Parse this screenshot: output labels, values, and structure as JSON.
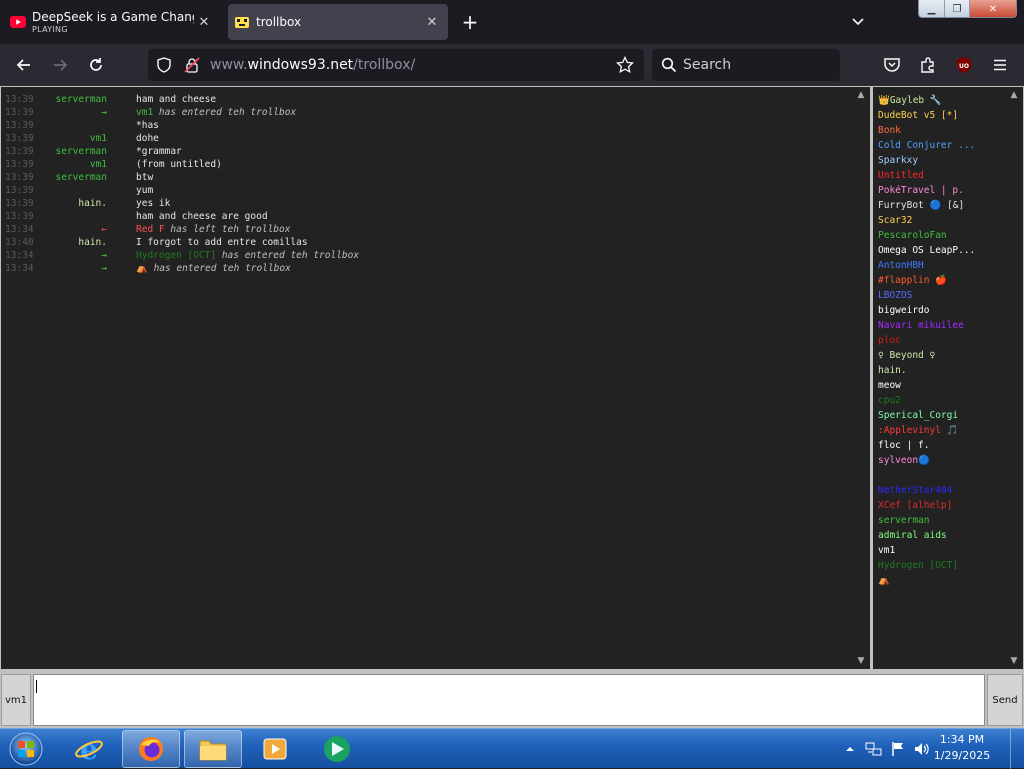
{
  "browser": {
    "tabs": [
      {
        "title": "DeepSeek is a Game Changer fo",
        "subtitle": "PLAYING",
        "active": false
      },
      {
        "title": "trollbox",
        "subtitle": "",
        "active": true
      }
    ],
    "url": {
      "prefix": "www.",
      "domain": "windows93.net",
      "path": "/trollbox/"
    },
    "search_placeholder": "Search",
    "colors": {
      "tabstrip": "#1c1b22",
      "active_tab": "#42414d",
      "toolbar": "#2b2a33"
    }
  },
  "chat": {
    "messages": [
      {
        "time": "13:39",
        "nick": "serverman",
        "nick_color": "#3fbf3f",
        "text": "ham and cheese",
        "type": "msg"
      },
      {
        "time": "13:39",
        "nick": "→",
        "nick_color": "#3ed83e",
        "who": "vm1",
        "who_color": "#3fbf3f",
        "text": "has entered teh trollbox",
        "type": "sys"
      },
      {
        "time": "13:39",
        "nick": "",
        "nick_color": "#3fbf3f",
        "text": "*has",
        "type": "msg"
      },
      {
        "time": "13:39",
        "nick": "vm1",
        "nick_color": "#3fbf3f",
        "text": "dohe",
        "type": "msg"
      },
      {
        "time": "13:39",
        "nick": "serverman",
        "nick_color": "#3fbf3f",
        "text": "*grammar",
        "type": "msg"
      },
      {
        "time": "13:39",
        "nick": "vm1",
        "nick_color": "#3fbf3f",
        "text": "(from untitled)",
        "type": "msg"
      },
      {
        "time": "13:39",
        "nick": "serverman",
        "nick_color": "#3fbf3f",
        "text": "btw",
        "type": "msg"
      },
      {
        "time": "13:39",
        "nick": "",
        "nick_color": "#3fbf3f",
        "text": "yum",
        "type": "msg"
      },
      {
        "time": "13:39",
        "nick": "hain.",
        "nick_color": "#cfe8a6",
        "text": "yes ik",
        "type": "msg"
      },
      {
        "time": "13:39",
        "nick": "",
        "nick_color": "#cfe8a6",
        "text": "ham and cheese are good",
        "type": "msg"
      },
      {
        "time": "13:34",
        "nick": "←",
        "nick_color": "#ff5252",
        "who": "Red F",
        "who_color": "#ff5252",
        "text": "has left teh trollbox",
        "type": "sys"
      },
      {
        "time": "13:40",
        "nick": "hain.",
        "nick_color": "#cfe8a6",
        "text": "I forgot to add entre comillas",
        "type": "msg"
      },
      {
        "time": "13:34",
        "nick": "→",
        "nick_color": "#3ed83e",
        "who": "Hydrogen [OCT]",
        "who_color": "#1f7a1f",
        "text": "has entered teh trollbox",
        "type": "sys"
      },
      {
        "time": "13:34",
        "nick": "→",
        "nick_color": "#3ed83e",
        "who": "⛺",
        "who_color": "#ff6b6b",
        "text": "has entered teh trollbox",
        "type": "sys"
      }
    ],
    "users": [
      {
        "name": "👑Gayleb 🔧",
        "color": "#cfe8a6"
      },
      {
        "name": "DudeBot v5 [*]",
        "color": "#ffd24a"
      },
      {
        "name": "Bonk",
        "color": "#ff6b3d"
      },
      {
        "name": "Cold Conjurer ...",
        "color": "#4fa0ff"
      },
      {
        "name": "Sparkxy",
        "color": "#9fd0ff"
      },
      {
        "name": "Untitled",
        "color": "#ff2a2a"
      },
      {
        "name": "PokéTravel | p.",
        "color": "#ff8ad8"
      },
      {
        "name": "FurryBot 🔵 [&]",
        "color": "#e0e0e0"
      },
      {
        "name": "Scar32",
        "color": "#ffd24a"
      },
      {
        "name": "PescaroloFan",
        "color": "#3fbf3f"
      },
      {
        "name": "Omega OS LeapP...",
        "color": "#ffffff"
      },
      {
        "name": "AntonHBH",
        "color": "#3a7bff"
      },
      {
        "name": "#flapplin 🍎",
        "color": "#ff5a2a"
      },
      {
        "name": "LBOZOS",
        "color": "#5a6bff"
      },
      {
        "name": "bigweirdo",
        "color": "#ffffff"
      },
      {
        "name": "Navari mikuilee",
        "color": "#a52aff"
      },
      {
        "name": "ploc",
        "color": "#d41a1a"
      },
      {
        "name": "♀ Beyond ♀",
        "color": "#cfe8a6"
      },
      {
        "name": "hain.",
        "color": "#cfe8a6"
      },
      {
        "name": "meow",
        "color": "#ffffff"
      },
      {
        "name": "cpu2",
        "color": "#1f7a1f"
      },
      {
        "name": "Sperical_Corgi",
        "color": "#7fffb0"
      },
      {
        "name": ":Applevinyl 🎵",
        "color": "#ff3a3a"
      },
      {
        "name": "floc | f.",
        "color": "#ffffff"
      },
      {
        "name": "sylveon🔵",
        "color": "#ff8ad8"
      },
      {
        "name": "",
        "color": "#222222"
      },
      {
        "name": "NetherStar404",
        "color": "#2a2aff"
      },
      {
        "name": "XCef [alhelp]",
        "color": "#e02a2a"
      },
      {
        "name": "serverman",
        "color": "#3fbf3f"
      },
      {
        "name": "admiral aids",
        "color": "#7fff7f"
      },
      {
        "name": "vm1",
        "color": "#ffffff"
      },
      {
        "name": "Hydrogen [OCT]",
        "color": "#1f7a1f"
      },
      {
        "name": "⛺",
        "color": "#ff6b6b"
      }
    ],
    "nick_button": "vm1",
    "send_button": "Send",
    "input_value": ""
  },
  "taskbar": {
    "clock_time": "1:34 PM",
    "clock_date": "1/29/2025",
    "apps": [
      "internet-explorer",
      "firefox",
      "file-explorer",
      "media-player",
      "sites"
    ]
  }
}
